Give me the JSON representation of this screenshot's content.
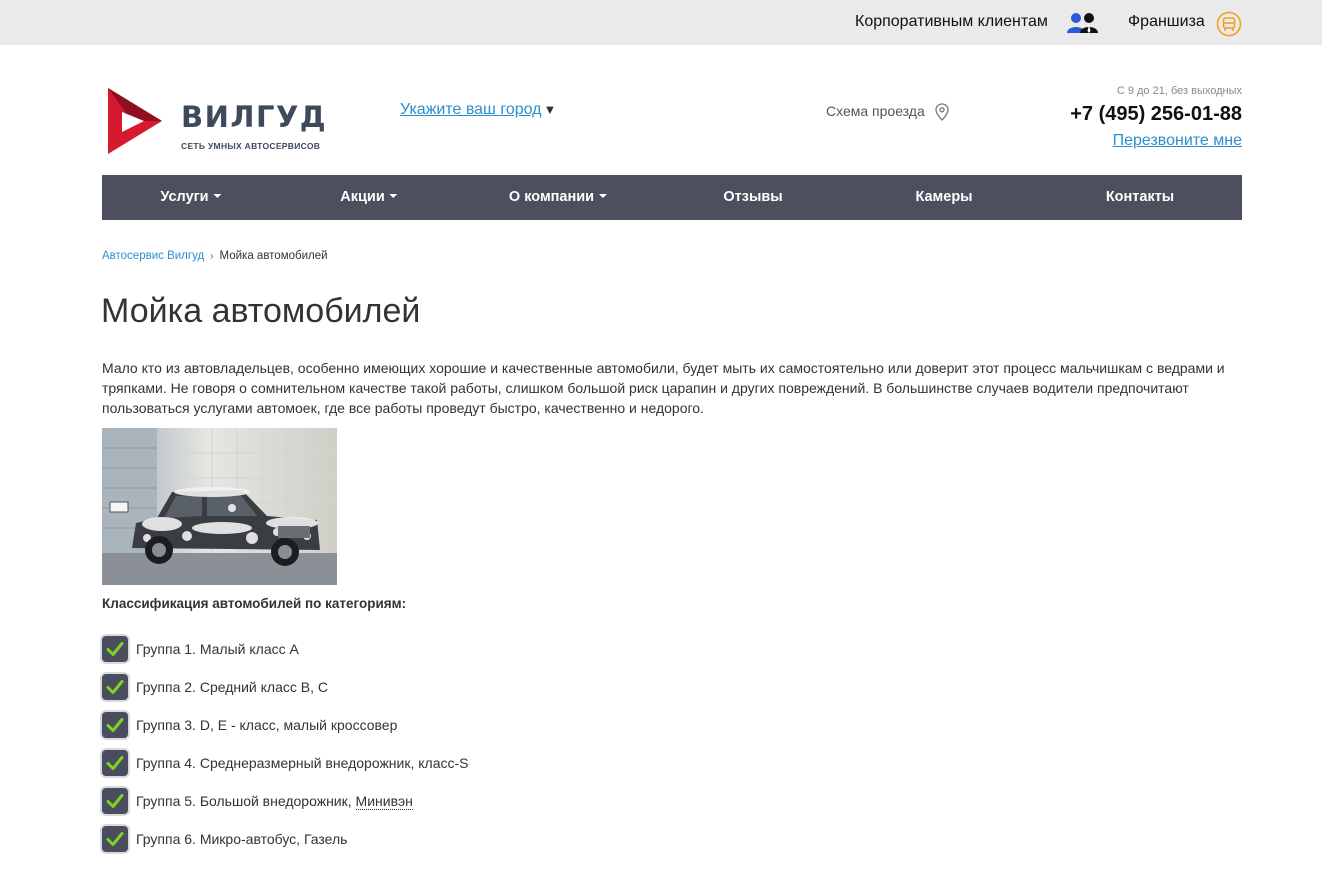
{
  "topbar": {
    "corporate_label": "Корпоративным клиентам",
    "corporate_icon": "corporate-clients-icon",
    "franchise_label": "Франшиза",
    "franchise_icon": "franchise-icon"
  },
  "header": {
    "logo_brand": "ВИЛГУД",
    "logo_tagline": "СЕТЬ УМНЫХ АВТОСЕРВИСОВ",
    "city_label": "Укажите ваш город",
    "city_arrow": "▼",
    "route_label": "Схема проезда",
    "route_icon": "map-pin-icon",
    "hours": "С 9 до 21, без выходных",
    "phone": "+7 (495) 256-01-88",
    "callback_label": "Перезвоните мне"
  },
  "nav": {
    "items": [
      {
        "label": "Услуги",
        "dropdown": true
      },
      {
        "label": "Акции",
        "dropdown": true
      },
      {
        "label": "О компании",
        "dropdown": true
      },
      {
        "label": "Отзывы",
        "dropdown": false
      },
      {
        "label": "Камеры",
        "dropdown": false
      },
      {
        "label": "Контакты",
        "dropdown": false
      }
    ]
  },
  "breadcrumb": {
    "home": "Автосервис Вилгуд",
    "separator": "›",
    "current": "Мойка автомобилей"
  },
  "page": {
    "title": "Мойка автомобилей",
    "intro": "Мало кто из автовладельцев, особенно имеющих хорошие и качественные автомобили, будет мыть их самостоятельно или доверит этот процесс мальчишкам с ведрами и тряпками. Не говоря о сомнительном качестве такой работы, слишком большой риск царапин и других повреждений. В большинстве случаев водители предпочитают пользоваться услугами автомоек, где все работы проведут быстро, качественно и недорого.",
    "subheading": "Классификация автомобилей по категориям:",
    "groups": [
      {
        "text": "Группа 1. Малый класс А"
      },
      {
        "text": "Группа 2. Средний класс В, С"
      },
      {
        "text": "Группа 3. D, E - класс, малый кроссовер"
      },
      {
        "text": "Группа 4. Среднеразмерный внедорожник, класс-S"
      },
      {
        "text": "Группа 5. Большой внедорожник, ",
        "term": "Минивэн"
      },
      {
        "text": "Группа 6. Микро-автобус, Газель"
      }
    ]
  },
  "colors": {
    "accent_link": "#2b8fcf",
    "nav_bg": "#4d4f5f",
    "logo_red": "#d7192f",
    "check_green": "#7ed321"
  }
}
